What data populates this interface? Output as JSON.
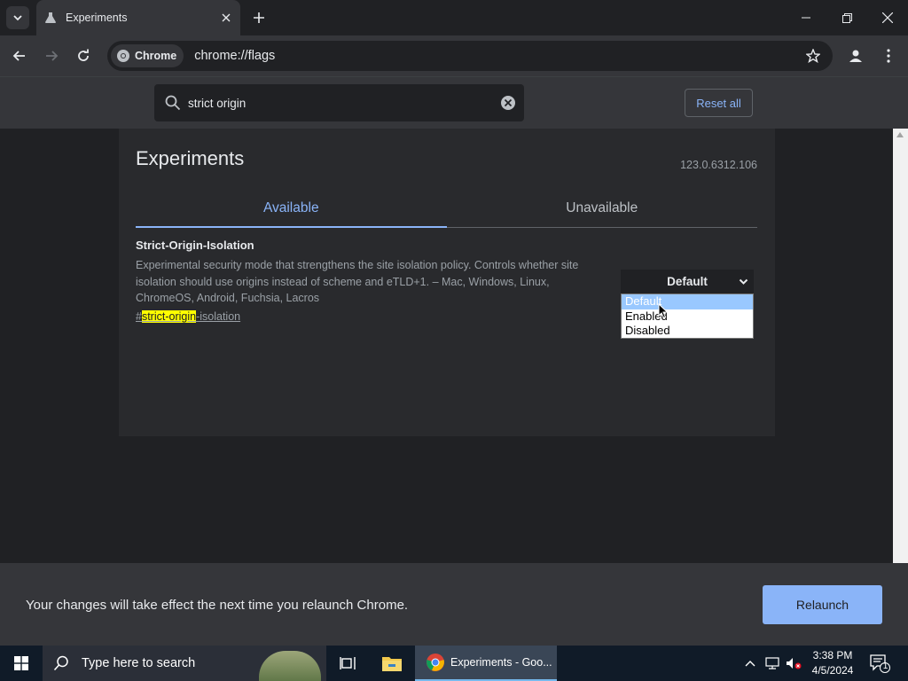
{
  "browser": {
    "tab_title": "Experiments",
    "chip_label": "Chrome",
    "url": "chrome://flags"
  },
  "flags_header": {
    "search_value": "strict origin",
    "reset_label": "Reset all"
  },
  "page": {
    "heading": "Experiments",
    "version": "123.0.6312.106",
    "tabs": [
      {
        "label": "Available"
      },
      {
        "label": "Unavailable"
      }
    ]
  },
  "experiment": {
    "name": "Strict-Origin-Isolation",
    "description": "Experimental security mode that strengthens the site isolation policy. Controls whether site isolation should use origins instead of scheme and eTLD+1. – Mac, Windows, Linux, ChromeOS, Android, Fuchsia, Lacros",
    "link_prefix": "#",
    "link_highlight": "strict-origin",
    "link_suffix": "-isolation",
    "select_value": "Default",
    "options": [
      "Default",
      "Enabled",
      "Disabled"
    ]
  },
  "footer": {
    "message": "Your changes will take effect the next time you relaunch Chrome.",
    "relaunch_label": "Relaunch"
  },
  "taskbar": {
    "search_placeholder": "Type here to search",
    "app_label": "Experiments - Goo...",
    "time": "3:38 PM",
    "date": "4/5/2024",
    "notification_count": "1"
  },
  "colors": {
    "accent": "#8ab4f8",
    "highlight": "#ffff00",
    "background": "#202124"
  }
}
